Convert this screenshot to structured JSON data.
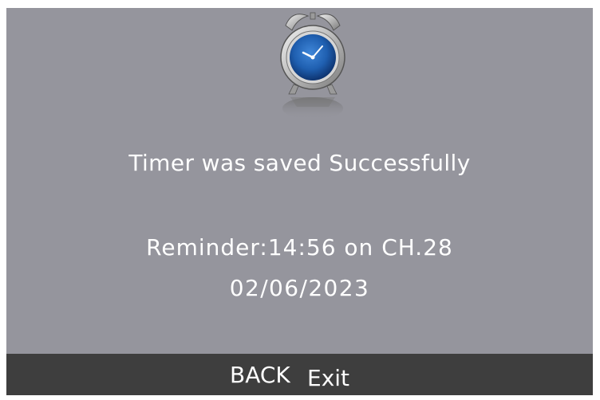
{
  "dialog": {
    "icon": "alarm-clock-icon",
    "title": "Timer was saved Successfully",
    "reminder": "Reminder:14:56 on CH.28",
    "date": "02/06/2023"
  },
  "footer": {
    "back_label": "BACK",
    "exit_label": "Exit"
  },
  "colors": {
    "background": "#95959d",
    "footer": "#3e3e3e",
    "text": "#ffffff",
    "clock_face": "#1f5fb0"
  }
}
